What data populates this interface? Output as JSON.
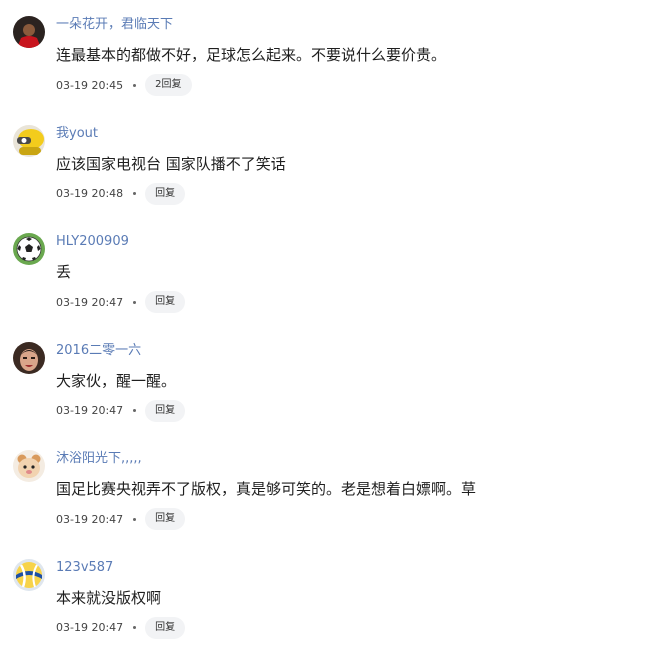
{
  "comments": [
    {
      "username": "一朵花开，君临天下",
      "content": "连最基本的都做不好，足球怎么起来。不要说什么要价贵。",
      "time": "03-19 20:45",
      "reply_label": "2回复",
      "avatar_icon": "avatar-red-jersey-player"
    },
    {
      "username": "我yout",
      "content": "应该国家电视台 国家队播不了笑话",
      "time": "03-19 20:48",
      "reply_label": "回复",
      "avatar_icon": "avatar-yellow-character"
    },
    {
      "username": "HLY200909",
      "content": "丢",
      "time": "03-19 20:47",
      "reply_label": "回复",
      "avatar_icon": "avatar-soccer-ball"
    },
    {
      "username": "2016二零一六",
      "content": "大家伙，醒一醒。",
      "time": "03-19 20:47",
      "reply_label": "回复",
      "avatar_icon": "avatar-face-photo"
    },
    {
      "username": "沐浴阳光下,,,,,",
      "content": "国足比赛央视弄不了版权，真是够可笑的。老是想着白嫖啊。草",
      "time": "03-19 20:47",
      "reply_label": "回复",
      "avatar_icon": "avatar-cartoon-character"
    },
    {
      "username": "123v587",
      "content": "本来就没版权啊",
      "time": "03-19 20:47",
      "reply_label": "回复",
      "avatar_icon": "avatar-volleyball"
    }
  ]
}
